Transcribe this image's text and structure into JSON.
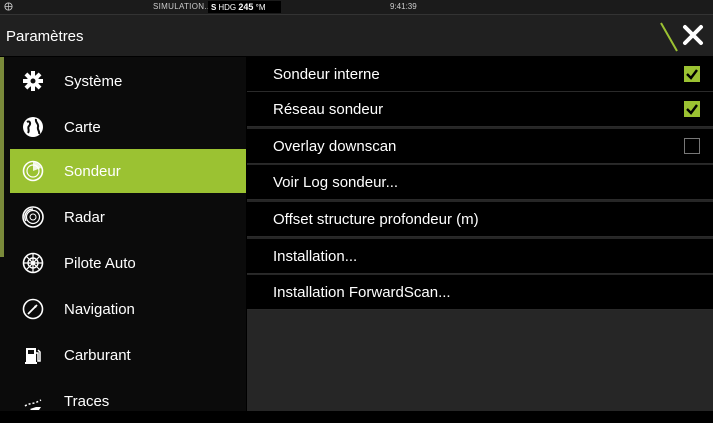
{
  "status_bar": {
    "simulation": "SIMULATION...",
    "heading_prefix": "S",
    "heading_label": "HDG",
    "heading_value": "245",
    "heading_unit": "°M",
    "time": "9:41:39"
  },
  "title_bar": {
    "title": "Paramètres"
  },
  "sidebar": {
    "items": [
      {
        "label": "Système",
        "icon": "gear-icon"
      },
      {
        "label": "Carte",
        "icon": "globe-icon"
      },
      {
        "label": "Sondeur",
        "icon": "sonar-icon",
        "active": true
      },
      {
        "label": "Radar",
        "icon": "radar-icon"
      },
      {
        "label": "Pilote Auto",
        "icon": "helm-icon"
      },
      {
        "label": "Navigation",
        "icon": "compass-icon"
      },
      {
        "label": "Carburant",
        "icon": "fuel-pump-icon"
      },
      {
        "label": "Traces",
        "icon": "trail-icon"
      }
    ]
  },
  "main": {
    "rows": [
      {
        "label": "Sondeur interne",
        "checkbox": "checked"
      },
      {
        "label": "Réseau sondeur",
        "checkbox": "checked"
      },
      {
        "label": "Overlay downscan",
        "checkbox": "unchecked"
      },
      {
        "label": "Voir Log sondeur..."
      },
      {
        "label": "Offset structure profondeur (m)"
      },
      {
        "label": "Installation..."
      },
      {
        "label": "Installation ForwardScan..."
      }
    ]
  },
  "colors": {
    "accent": "#9bc232",
    "background": "#000000",
    "panel": "#262626"
  }
}
